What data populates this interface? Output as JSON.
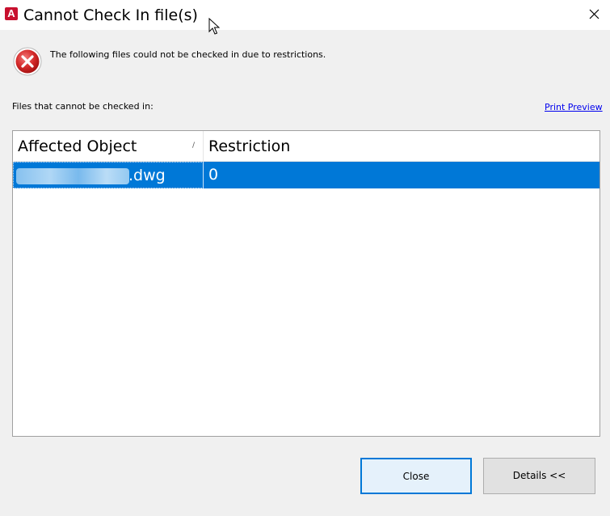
{
  "window": {
    "title": "Cannot Check In file(s)",
    "app_icon_letter": "A",
    "app_icon_color": "#c8102e"
  },
  "dialog": {
    "message": "The following files could not be checked in due to restrictions.",
    "files_label": "Files that cannot be checked in:",
    "print_preview_link": "Print Preview"
  },
  "grid": {
    "columns": [
      "Affected Object",
      "Restriction"
    ],
    "sort_indicator": "/",
    "rows": [
      {
        "object_suffix": "dwg",
        "restriction": "0",
        "selected": true
      }
    ],
    "selection_color": "#0078d7"
  },
  "buttons": {
    "close_label": "Close",
    "details_label": "Details <<"
  },
  "icons": {
    "error": "error-x-icon",
    "window_close": "close-icon",
    "cursor": "mouse-pointer-icon"
  }
}
